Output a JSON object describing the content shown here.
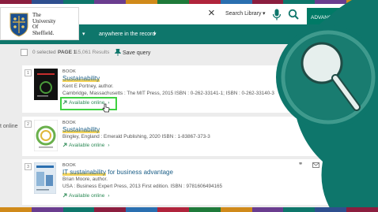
{
  "brand": {
    "colors": {
      "teal": "#0e766b",
      "accent_green": "#3ed140",
      "link_blue": "#1b5e87",
      "avail_green": "#2e8b57"
    },
    "strip_colors": [
      "#8b1e3f",
      "#2f4f8f",
      "#0e766b",
      "#6a3d8f",
      "#d08a1a",
      "#1f7a3a",
      "#b0243c",
      "#2a6fb0",
      "#8b1e3f",
      "#0e766b",
      "#6a3d8f",
      "#d08a1a"
    ]
  },
  "logo": {
    "line1": "The",
    "line2": "University",
    "line3": "Of",
    "line4": "Sheffield."
  },
  "search": {
    "clear_icon": "close-icon",
    "scope": "Search Library",
    "advanced": "ADVANC"
  },
  "filters": {
    "where": "anywhere in the record"
  },
  "results_bar": {
    "selected": "0 selected",
    "page": "PAGE 1",
    "count": "15,061 Results",
    "save_query": "Save query"
  },
  "left_edge_text": "t online",
  "results": [
    {
      "num": "1",
      "type": "BOOK",
      "title_highlight": "Sustainability",
      "title_rest": "",
      "author": "Kent E Portney, author.",
      "publisher": "Cambridge, Massachusetts : The MIT Press, 2015 ISBN : 0-262-33141-1; ISBN : 0-262-33140-3",
      "availability": "Available online",
      "chevron": "›"
    },
    {
      "num": "2",
      "type": "BOOK",
      "title_highlight": "Sustainability",
      "title_rest": "",
      "author": "",
      "publisher": "Bingley, England : Emerald Publishing, 2020 ISBN : 1-83867-373-3",
      "availability": "Available online",
      "chevron": "›"
    },
    {
      "num": "3",
      "type": "BOOK",
      "title_highlight": "IT sustainability",
      "title_rest": " for business advantage",
      "author": "Brian Moore, author.",
      "publisher": "USA : Business Expert Press, 2013 First edition. ISBN : 9781606494165",
      "availability": "Available online",
      "chevron": "›"
    }
  ],
  "result_tools": {
    "quote_glyph": "❞"
  }
}
